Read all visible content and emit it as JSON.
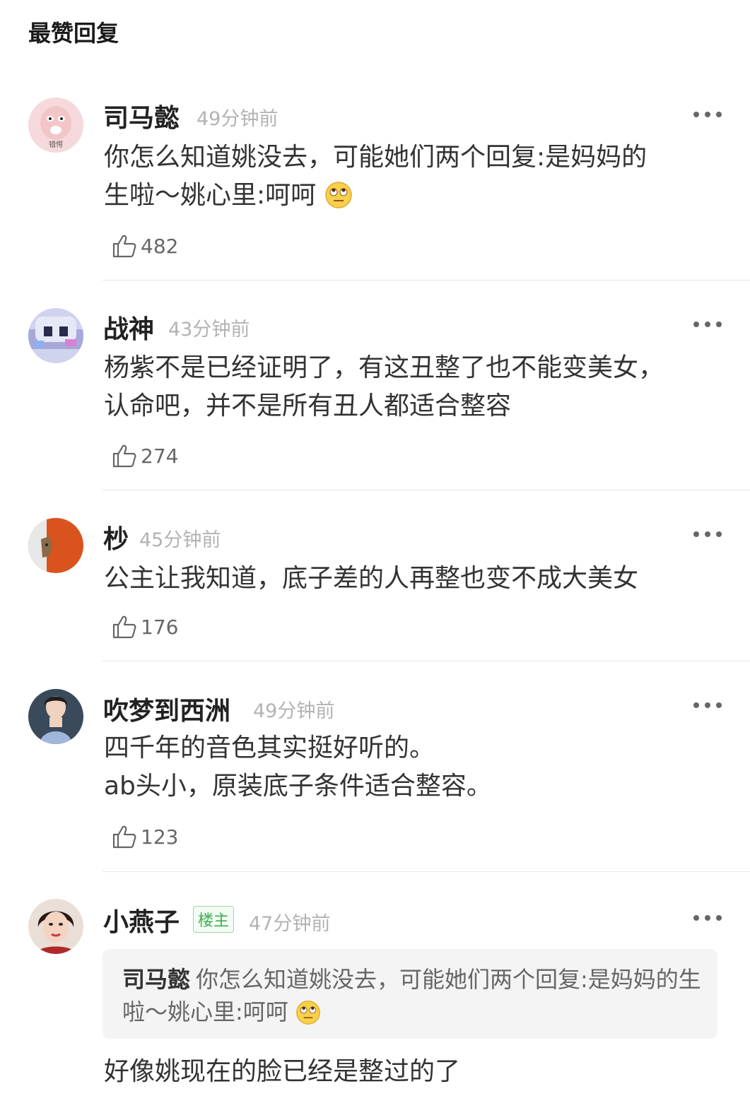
{
  "section_title": "最赞回复",
  "comments": [
    {
      "user": "司马懿",
      "time": "49分钟前",
      "text": "你怎么知道姚没去，可能她们两个回复:是妈妈的\n生啦～姚心里:呵呵",
      "emoji": "eye-roll-emoji",
      "likes": "482"
    },
    {
      "user": "战神",
      "time": "43分钟前",
      "text": "杨紫不是已经证明了，有这丑整了也不能变美女，\n认命吧，并不是所有丑人都适合整容",
      "likes": "274"
    },
    {
      "user": "杪",
      "time": "45分钟前",
      "text": "公主让我知道，底子差的人再整也变不成大美女",
      "likes": "176"
    },
    {
      "user": "吹梦到西洲",
      "time": "49分钟前",
      "text": "四千年的音色其实挺好听的。\nab头小，原装底子条件适合整容。",
      "likes": "123"
    },
    {
      "user": "小燕子",
      "badge": "楼主",
      "time": "47分钟前",
      "quote": {
        "user": "司马懿",
        "text": "你怎么知道姚没去，可能她们两个回复:是妈妈的生啦～姚心里:呵呵"
      },
      "text": "好像姚现在的脸已经是整过的了"
    }
  ],
  "icons": {
    "like": "thumbs-up-icon",
    "more": "more-dots-icon"
  },
  "avatar_caption_1": "错愕",
  "colors": {
    "badge_green": "#3fae4f",
    "time_gray": "#b3b3b3"
  }
}
